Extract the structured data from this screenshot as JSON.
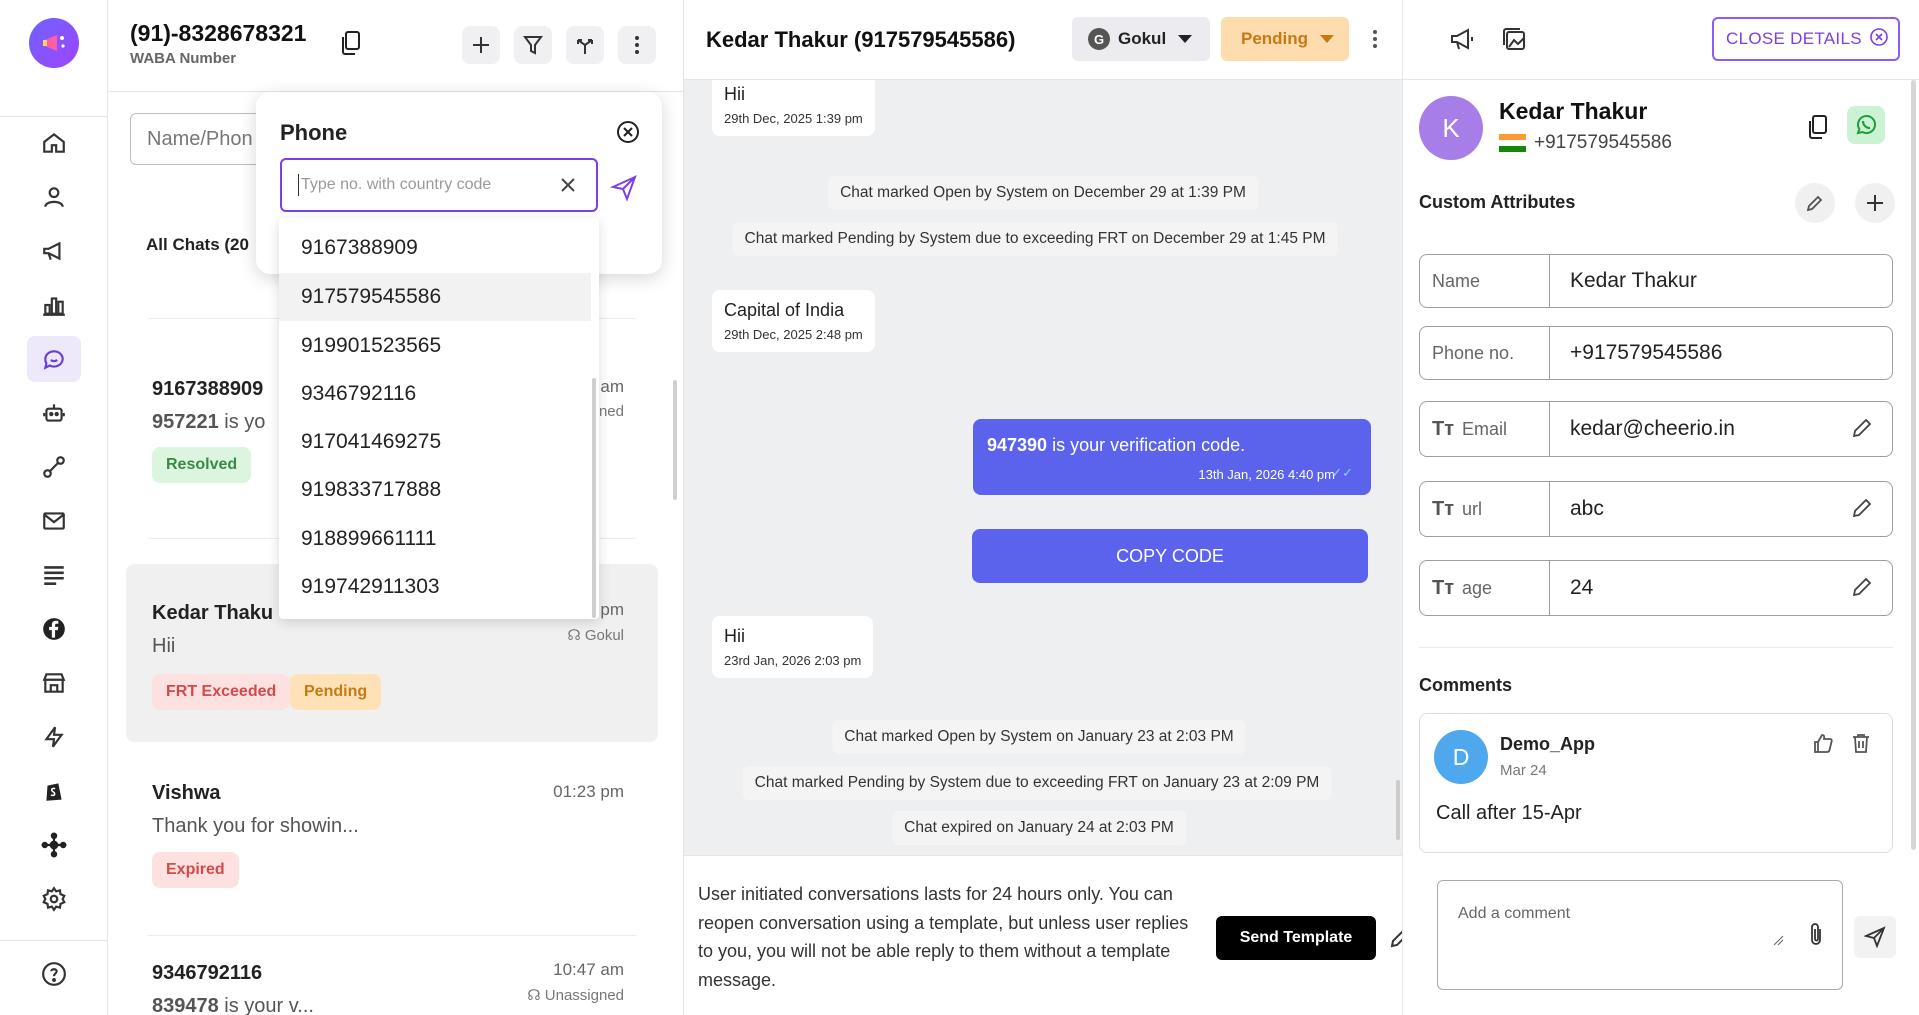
{
  "colors": {
    "accent": "#7b3fe4",
    "outgoing": "#5b63ec",
    "pending": "#ffdcae",
    "resolved": "#dcf5df",
    "expired": "#fde1e1"
  },
  "sidebar": {
    "icons": [
      "logo-icon",
      "home-icon",
      "contacts-icon",
      "broadcast-icon",
      "analytics-icon",
      "chats-icon",
      "bot-icon",
      "flows-icon",
      "email-icon",
      "templates-icon",
      "facebook-icon",
      "store-icon",
      "automation-icon",
      "shopify-icon",
      "integrations-icon",
      "settings-icon",
      "help-icon"
    ],
    "active": "chats-icon"
  },
  "list": {
    "waba_phone": "(91)-8328678321",
    "waba_label": "WABA Number",
    "search_placeholder": "Name/Phon",
    "all_chats": "All Chats (20",
    "chats": [
      {
        "name": "9167388909",
        "msg_bold": "957221",
        "msg": " is yo",
        "time": "am",
        "agent": "ned",
        "tags": [
          "Resolved"
        ]
      },
      {
        "name": "Kedar Thaku",
        "msg_bold": "",
        "msg": "Hii",
        "time": "pm",
        "agent": "Gokul",
        "tags": [
          "FRT Exceeded",
          "Pending"
        ]
      },
      {
        "name": "Vishwa",
        "msg_bold": "",
        "msg": "Thank you for showin...",
        "time": "01:23 pm",
        "agent": "",
        "tags": [
          "Expired"
        ]
      },
      {
        "name": "9346792116",
        "msg_bold": "839478",
        "msg": " is your v...",
        "time": "10:47 am",
        "agent": "Unassigned",
        "tags": []
      }
    ]
  },
  "popup": {
    "title": "Phone",
    "input_placeholder": "Type no. with country code",
    "options": [
      "9167388909",
      "917579545586",
      "919901523565",
      "9346792116",
      "917041469275",
      "919833717888",
      "918899661111",
      "919742911303"
    ],
    "highlighted": "917579545586"
  },
  "chat": {
    "title": "Kedar Thakur (917579545586)",
    "agent": "Gokul",
    "agent_initial": "G",
    "status": "Pending",
    "messages": [
      {
        "type": "in",
        "text": "Hii",
        "date": "29th Dec, 2025 1:39 pm"
      },
      {
        "type": "sys",
        "text": "Chat marked Open by System on December 29 at 1:39 PM"
      },
      {
        "type": "sys",
        "text": "Chat marked Pending by System due to exceeding FRT on December 29 at 1:45 PM"
      },
      {
        "type": "in",
        "text": "Capital of India",
        "date": "29th Dec, 2025 2:48 pm"
      },
      {
        "type": "out",
        "bold": "947390",
        "text": " is your verification code.",
        "date": "13th Jan, 2026 4:40 pm"
      },
      {
        "type": "button",
        "text": "COPY CODE"
      },
      {
        "type": "in",
        "text": "Hii",
        "date": "23rd Jan, 2026 2:03 pm"
      },
      {
        "type": "sys",
        "text": "Chat marked Open by System on January 23 at 2:03 PM"
      },
      {
        "type": "sys",
        "text": "Chat marked Pending by System due to exceeding FRT on January 23 at 2:09 PM"
      },
      {
        "type": "sys",
        "text": "Chat expired on January 24 at 2:03 PM"
      }
    ],
    "composer_note": "User initiated conversations lasts for 24 hours only. You can reopen conversation using a template, but unless user replies to you, you will not be able reply to them without a template message.",
    "send_template": "Send Template"
  },
  "details": {
    "close_label": "CLOSE DETAILS",
    "avatar_initial": "K",
    "name": "Kedar Thakur",
    "phone": "+917579545586",
    "custom_attributes_title": "Custom Attributes",
    "attributes": [
      {
        "label": "Name",
        "value": "Kedar Thakur",
        "editable": false
      },
      {
        "label": "Phone no.",
        "value": "+917579545586",
        "editable": false
      },
      {
        "label": "Email",
        "value": "kedar@cheerio.in",
        "editable": true
      },
      {
        "label": "url",
        "value": "abc",
        "editable": true
      },
      {
        "label": "age",
        "value": "24",
        "editable": true
      }
    ],
    "comments_title": "Comments",
    "comment": {
      "initial": "D",
      "author": "Demo_App",
      "date": "Mar 24",
      "text": "Call after 15-Apr"
    },
    "add_comment_placeholder": "Add a comment"
  }
}
